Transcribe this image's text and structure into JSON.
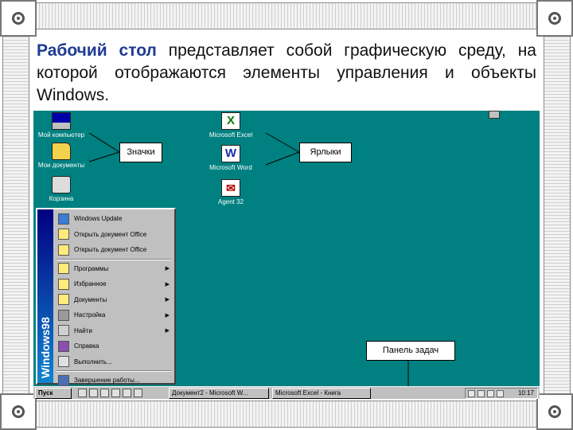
{
  "slide": {
    "heading_accent": "Рабочий стол",
    "heading_rest": " представляет собой графическую среду, на которой отображаются элементы управления и объекты Windows."
  },
  "desktop": {
    "icons_left": [
      {
        "label": "Мой компьютер",
        "icon": "my-computer-icon"
      },
      {
        "label": "Мои документы",
        "icon": "my-documents-icon"
      },
      {
        "label": "Корзина",
        "icon": "recycle-bin-icon"
      }
    ],
    "icons_center": [
      {
        "label": "Microsoft Excel",
        "icon": "excel-icon",
        "glyph": "X"
      },
      {
        "label": "Microsoft Word",
        "icon": "word-icon",
        "glyph": "W"
      },
      {
        "label": "Agent 32",
        "icon": "mail-agent-icon",
        "glyph": "✉"
      }
    ],
    "callouts": {
      "icons": "Значки",
      "shortcuts": "Ярлыки",
      "taskbar": "Панель задач"
    }
  },
  "start_menu": {
    "brand": "Windows98",
    "items": [
      {
        "label": "Windows Update",
        "submenu": false
      },
      {
        "label": "Открыть документ Office",
        "submenu": false
      },
      {
        "label": "Открыть документ Office",
        "submenu": false
      },
      {
        "label": "Программы",
        "submenu": true
      },
      {
        "label": "Избранное",
        "submenu": true
      },
      {
        "label": "Документы",
        "submenu": true
      },
      {
        "label": "Настройка",
        "submenu": true
      },
      {
        "label": "Найти",
        "submenu": true
      },
      {
        "label": "Справка",
        "submenu": false
      },
      {
        "label": "Выполнить...",
        "submenu": false
      },
      {
        "label": "Завершение работы...",
        "submenu": false
      }
    ],
    "submenu_arrow": "▶"
  },
  "taskbar": {
    "start_label": "Пуск",
    "tasks": [
      {
        "label": "Документ2 - Microsoft W..."
      },
      {
        "label": "Microsoft Excel - Книга"
      }
    ],
    "clock": "10:17"
  },
  "colors": {
    "desktop": "#008080",
    "accent_text": "#1f3a93"
  }
}
